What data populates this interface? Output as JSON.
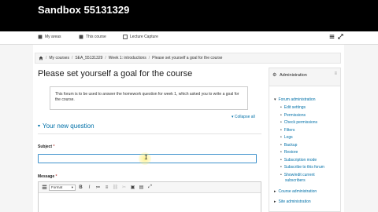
{
  "site": {
    "title": "Sandbox 55131329"
  },
  "nav": {
    "my_areas": "My areas",
    "this_course": "This course",
    "lecture_capture": "Lecture Capture"
  },
  "breadcrumb": {
    "items": [
      "My courses",
      "SEA_55131329",
      "Week 1: introductions",
      "Please set yourself a goal for the course"
    ]
  },
  "page": {
    "title": "Please set yourself a goal for the course",
    "intro": "This forum is to be used to answer the homework question for week 1, which asked you to write a goal for the course.",
    "collapse_all": "Collapse all",
    "section_heading": "Your new question",
    "subject_label": "Subject",
    "subject_value": "",
    "message_label": "Message",
    "required_marker": "*"
  },
  "editor": {
    "format_select": "Format",
    "buttons": [
      "B",
      "I",
      "≔",
      "≡",
      "⛓",
      "✂",
      "▣",
      "▤",
      "⤢"
    ]
  },
  "admin": {
    "title": "Administration",
    "forum_admin": "Forum administration",
    "items": [
      "Edit settings",
      "Permissions",
      "Check permissions",
      "Filters",
      "Logs",
      "Backup",
      "Restore",
      "Subscription mode",
      "Subscribe to this forum",
      "Show/edit current",
      "subscribers"
    ],
    "course_admin": "Course administration",
    "site_admin": "Site administration"
  },
  "colors": {
    "link": "#0070a8",
    "header": "#000000",
    "focus": "#3e92cc"
  },
  "icons": {
    "home": "home-icon",
    "my_areas": "my-areas-icon",
    "this_course": "this-course-icon",
    "lecture": "lecture-capture-icon",
    "gear": "gear-icon"
  }
}
